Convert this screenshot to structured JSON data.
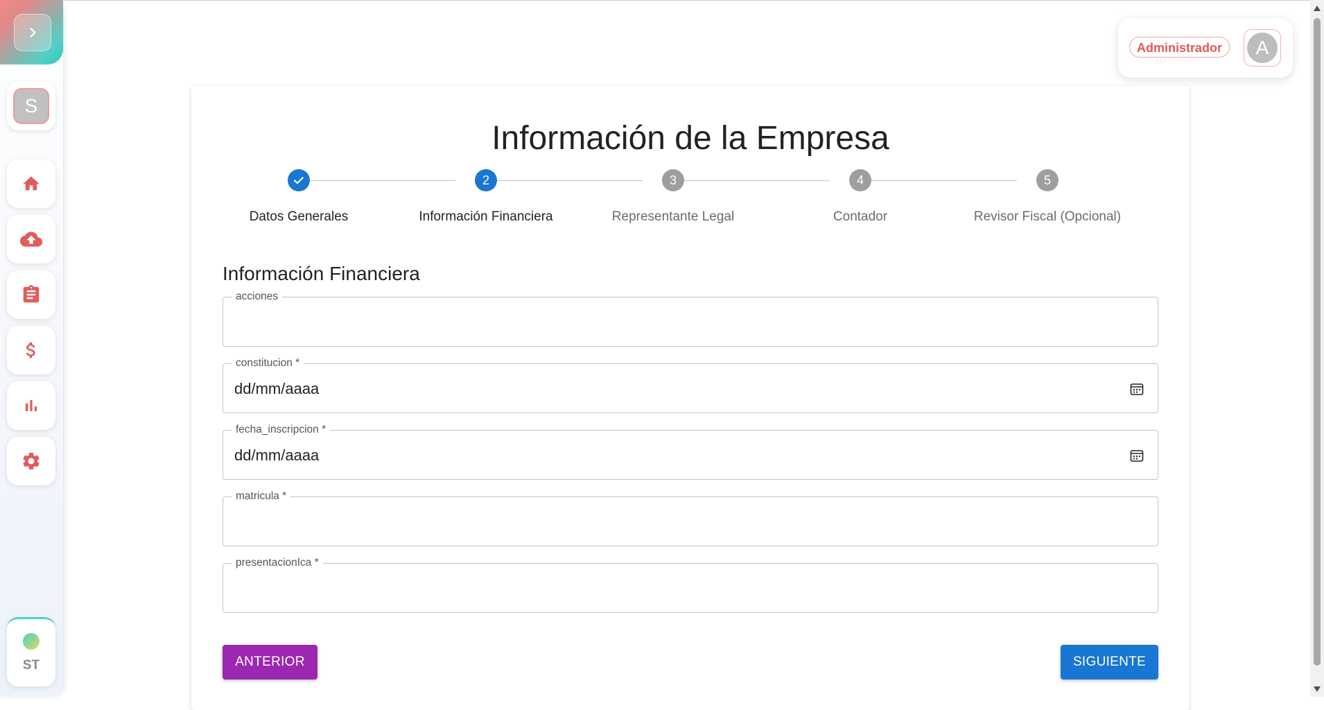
{
  "sidebar": {
    "avatar_letter": "S",
    "items": [
      {
        "name": "home-icon"
      },
      {
        "name": "cloud-upload-icon"
      },
      {
        "name": "clipboard-icon"
      },
      {
        "name": "dollar-icon"
      },
      {
        "name": "bar-chart-icon"
      },
      {
        "name": "gear-icon"
      }
    ],
    "footer_label": "ST",
    "accent": "#e25b5b"
  },
  "header": {
    "role_badge": "Administrador",
    "user_initial": "A"
  },
  "main": {
    "title": "Información de la Empresa",
    "steps": [
      {
        "label": "Datos Generales",
        "number": "1",
        "status": "done"
      },
      {
        "label": "Información Financiera",
        "number": "2",
        "status": "active"
      },
      {
        "label": "Representante Legal",
        "number": "3",
        "status": "pending"
      },
      {
        "label": "Contador",
        "number": "4",
        "status": "pending"
      },
      {
        "label": "Revisor Fiscal (Opcional)",
        "number": "5",
        "status": "pending"
      }
    ],
    "section_title": "Información Financiera",
    "fields": [
      {
        "label": "acciones",
        "value": ""
      },
      {
        "label": "constitucion *",
        "value": "dd/mm/aaaa"
      },
      {
        "label": "fecha_inscripcion *",
        "value": "dd/mm/aaaa"
      },
      {
        "label": "matricula *",
        "value": ""
      },
      {
        "label": "presentacionIca *",
        "value": ""
      }
    ],
    "prev_button": "ANTERIOR",
    "next_button": "SIGUIENTE"
  },
  "colors": {
    "primary": "#1976d2",
    "secondary": "#9c27b0",
    "sidebar_icon": "#e25b5b"
  }
}
